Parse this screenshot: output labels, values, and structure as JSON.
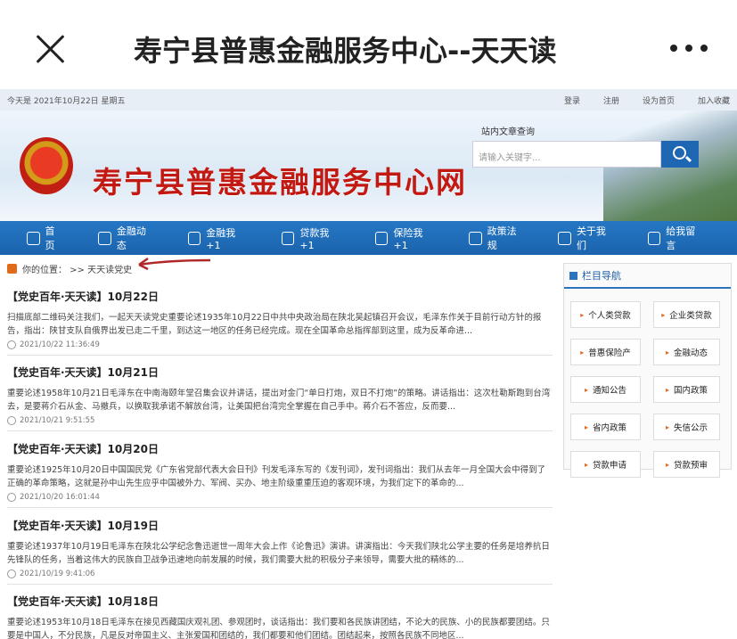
{
  "app": {
    "title": "寿宁县普惠金融服务中心--天天读"
  },
  "info_bar": {
    "date": "今天是 2021年10月22日 星期五",
    "links": [
      "登录",
      "注册",
      "设为首页",
      "加入收藏"
    ]
  },
  "banner": {
    "site_name": "寿宁县普惠金融服务中心网",
    "search_label": "站内文章查询",
    "search_placeholder": "请输入关键字..."
  },
  "nav": {
    "items": [
      "首页",
      "金融动态",
      "金融我+1",
      "贷款我+1",
      "保险我+1",
      "政策法规",
      "关于我们",
      "给我留言"
    ]
  },
  "breadcrumb": {
    "text": "你的位置： >> 天天读党史"
  },
  "articles": [
    {
      "title": "【党史百年·天天读】10月22日",
      "summary": "扫描底部二维码关注我们，一起天天读党史重要论述1935年10月22日中共中央政治局在陕北吴起镇召开会议，毛泽东作关于目前行动方针的报告，指出：陕甘支队自俄界出发已走二千里，到达这一地区的任务已经完成。现在全国革命总指挥部到这里，成为反革命进...",
      "date": "2021/10/22 11:36:49"
    },
    {
      "title": "【党史百年·天天读】10月21日",
      "summary": "重要论述1958年10月21日毛泽东在中南海颐年堂召集会议并讲话，提出对金门“单日打炮，双日不打炮”的策略。讲话指出：这次杜勒斯跑到台湾去，是要蒋介石从金、马撤兵，以换取我承诺不解放台湾，让美国把台湾完全掌握在自己手中。蒋介石不答应，反而要...",
      "date": "2021/10/21 9:51:55"
    },
    {
      "title": "【党史百年·天天读】10月20日",
      "summary": "重要论述1925年10月20日中国国民党《广东省党部代表大会日刊》刊发毛泽东写的《发刊词》，发刊词指出：我们从去年一月全国大会中得到了正确的革命策略，这就是孙中山先生应乎中国被外力、军阀、买办、地主阶级重重压迫的客观环境，为我们定下的革命的...",
      "date": "2021/10/20 16:01:44"
    },
    {
      "title": "【党史百年·天天读】10月19日",
      "summary": "重要论述1937年10月19日毛泽东在陕北公学纪念鲁迅逝世一周年大会上作《论鲁迅》演讲。讲演指出：今天我们陕北公学主要的任务是培养抗日先锋队的任务，当着这伟大的民族自卫战争迅速地向前发展的时候，我们需要大批的积极分子来领导，需要大批的精练的...",
      "date": "2021/10/19 9:41:06"
    },
    {
      "title": "【党史百年·天天读】10月18日",
      "summary": "重要论述1953年10月18日毛泽东在接见西藏国庆观礼团、参观团时，谈话指出：我们要和各民族讲团结，不论大的民族、小的民族都要团结。只要是中国人，不分民族，凡是反对帝国主义、主张爱国和团结的，我们都要和他们团结。团结起来，按照各民族不同地区...",
      "date": ""
    }
  ],
  "sidebar": {
    "title": "栏目导航",
    "items": [
      "个人类贷款",
      "企业类贷款",
      "普惠保险产",
      "金融动态",
      "通知公告",
      "国内政策",
      "省内政策",
      "失信公示",
      "贷款申请",
      "贷款预审"
    ]
  },
  "colors": {
    "nav": "#1f67b2",
    "site_name": "#c21a12",
    "accent": "#e06b1c"
  }
}
